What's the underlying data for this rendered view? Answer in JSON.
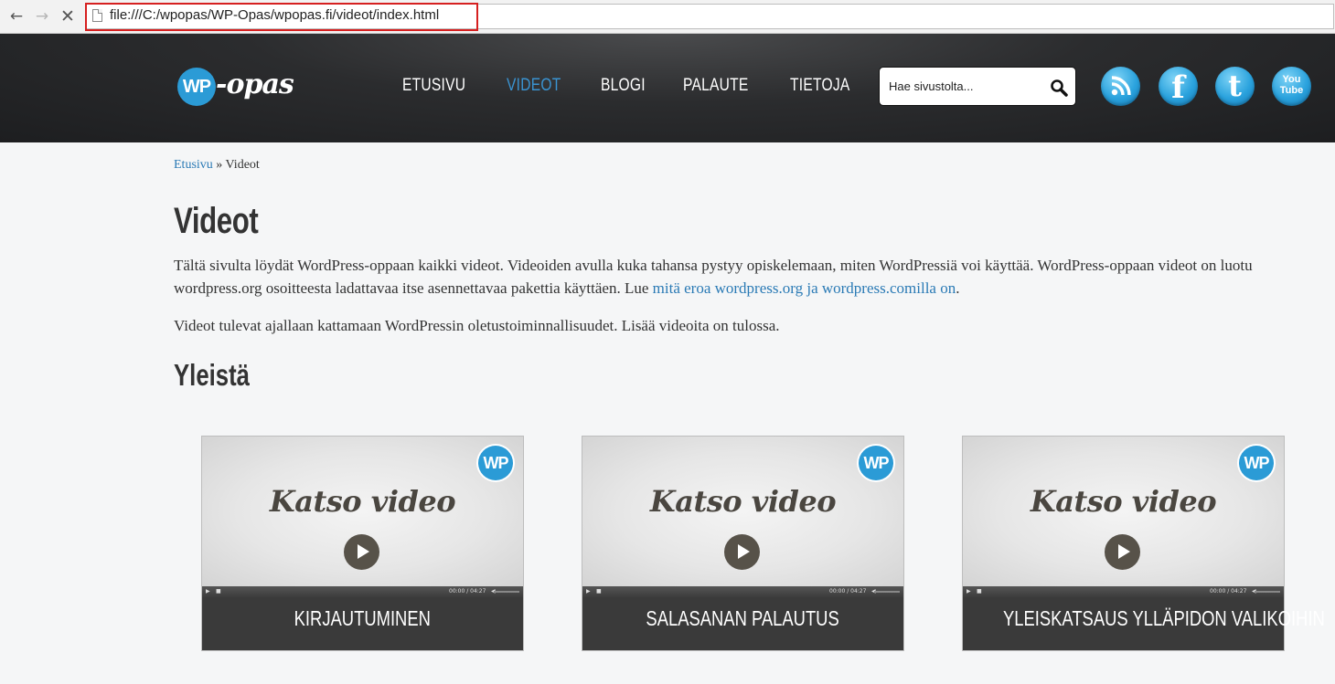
{
  "browser": {
    "back_icon": "arrow-left-icon",
    "forward_icon": "arrow-right-icon",
    "stop_icon": "close-icon",
    "url": "file:///C:/wpopas/WP-Opas/wpopas.fi/videot/index.html"
  },
  "header": {
    "logo_mark": "WP",
    "logo_text": "-opas",
    "nav": [
      {
        "label": "ETUSIVU"
      },
      {
        "label": "VIDEOT"
      },
      {
        "label": "BLOGI"
      },
      {
        "label": "PALAUTE"
      },
      {
        "label": "TIETOJA"
      }
    ],
    "active_nav": "VIDEOT",
    "search_placeholder": "Hae sivustolta...",
    "social": [
      {
        "icon": "rss-icon"
      },
      {
        "icon": "facebook-icon",
        "glyph": "f"
      },
      {
        "icon": "twitter-icon",
        "glyph": "t"
      },
      {
        "icon": "youtube-icon",
        "glyph_top": "You",
        "glyph_bottom": "Tube"
      }
    ]
  },
  "breadcrumb": {
    "home": "Etusivu",
    "separator": " » ",
    "current": "Videot"
  },
  "page": {
    "title": "Videot",
    "intro_line1": "Tältä sivulta löydät WordPress-oppaan kaikki videot. Videoiden avulla kuka tahansa pystyy opiskelemaan, miten WordPressiä voi käyttää. WordPress-oppaan videot on luotu",
    "intro_line2_before": "wordpress.org osoitteesta ladattavaa itse asennettavaa pakettia käyttäen. Lue ",
    "intro_link": "mitä eroa wordpress.org ja wordpress.comilla on",
    "intro_line2_after": ".",
    "intro2": "Videot tulevat ajallaan kattamaan WordPressin oletustoiminnallisuudet. Lisää videoita on tulossa.",
    "section_title": "Yleistä"
  },
  "videos": [
    {
      "thumb_badge": "WP",
      "thumb_text": "Katso video",
      "time": "00:00 / 04:27",
      "label": "KIRJAUTUMINEN"
    },
    {
      "thumb_badge": "WP",
      "thumb_text": "Katso video",
      "time": "00:00 / 04:27",
      "label": "SALASANAN PALAUTUS"
    },
    {
      "thumb_badge": "WP",
      "thumb_text": "Katso video",
      "time": "00:00 / 04:27",
      "label": "YLEISKATSAUS YLLÄPIDON VALIKOIHIN"
    }
  ],
  "colors": {
    "accent": "#2b9bd6",
    "link": "#2a7ab5",
    "header_bg": "#1d1e20",
    "highlight_box": "#d62020"
  }
}
